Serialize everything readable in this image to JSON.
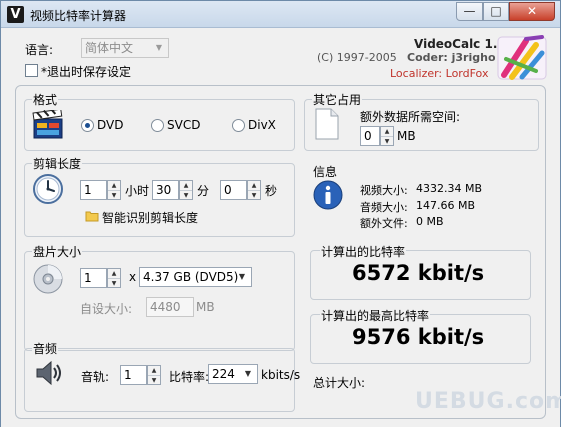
{
  "window": {
    "title": "视频比特率计算器",
    "app_icon_glyph": "V",
    "buttons": {
      "minimize": "—",
      "maximize": "□",
      "close": "✕"
    }
  },
  "top": {
    "language_label": "语言:",
    "language_value": "简体中文",
    "save_on_exit_label": "*退出时保存设定",
    "save_on_exit_checked": false,
    "product": "VideoCalc 1.1",
    "copyright": "(C) 1997-2005",
    "coder": "Coder: j3righo",
    "localizer": "Localizer: LordFox"
  },
  "format": {
    "title": "格式",
    "options": [
      {
        "label": "DVD",
        "selected": true
      },
      {
        "label": "SVCD",
        "selected": false
      },
      {
        "label": "DivX",
        "selected": false
      }
    ]
  },
  "clip_length": {
    "title": "剪辑长度",
    "hours": "1",
    "hours_label": "小时",
    "minutes": "30",
    "minutes_label": "分",
    "seconds": "0",
    "seconds_label": "秒",
    "auto_detect_label": "智能识别剪辑长度"
  },
  "disc_size": {
    "title": "盘片大小",
    "count": "1",
    "times_symbol": "x",
    "disc_value": "4.37 GB (DVD5)",
    "custom_label": "自设大小:",
    "custom_value": "4480",
    "custom_unit": "MB"
  },
  "audio": {
    "title": "音频",
    "tracks_label": "音轨:",
    "tracks_value": "1",
    "bitrate_label": "比特率:",
    "bitrate_value": "224",
    "bitrate_unit": "kbits/s"
  },
  "other": {
    "title": "其它占用",
    "extra_space_label": "额外数据所需空间:",
    "extra_space_value": "0",
    "extra_space_unit": "MB"
  },
  "info": {
    "title": "信息",
    "video_size_label": "视频大小:",
    "video_size_value": "4332.34 MB",
    "audio_size_label": "音频大小:",
    "audio_size_value": "147.66 MB",
    "extra_file_label": "额外文件:",
    "extra_file_value": "0 MB"
  },
  "results": {
    "calc_bitrate_label": "计算出的比特率",
    "calc_bitrate_value": "6572 kbit/s",
    "max_bitrate_label": "计算出的最高比特率",
    "max_bitrate_value": "9576 kbit/s",
    "total_size_label": "总计大小:"
  },
  "watermark": "UEBUG.com",
  "colors": {
    "accent": "#1d4f91",
    "localizer": "#c0332b",
    "info_icon": "#2a62b8"
  }
}
